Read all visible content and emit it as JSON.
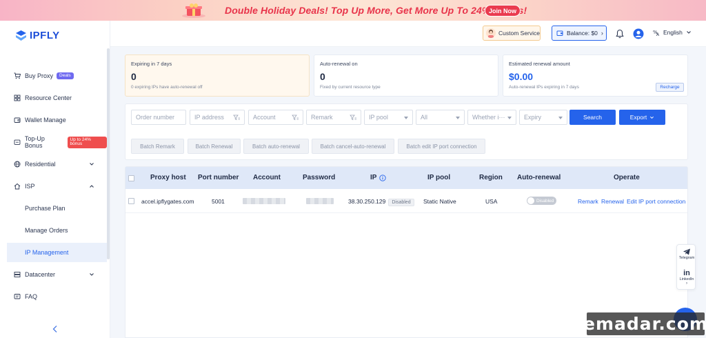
{
  "banner": {
    "text": "Double Holiday Deals! Top Up More, Get More Up To 24% Bonus!",
    "join_label": "Join Now"
  },
  "brand": {
    "name": "IPFLY",
    "accent": "#2563eb"
  },
  "sidebar": {
    "items": [
      {
        "label": "Buy Proxy",
        "icon": "cart-icon",
        "badge": "Deals"
      },
      {
        "label": "Resource Center",
        "icon": "grid-icon"
      },
      {
        "label": "Wallet Manage",
        "icon": "wallet-icon"
      },
      {
        "label": "Top-Up Bonus",
        "icon": "coupon-icon",
        "badge": "Up to 24% bonus"
      },
      {
        "label": "Residential",
        "icon": "globe-icon"
      },
      {
        "label": "ISP",
        "icon": "home-icon"
      },
      {
        "label": "Purchase Plan"
      },
      {
        "label": "Manage Orders"
      },
      {
        "label": "IP Management",
        "active": true
      },
      {
        "label": "Datacenter",
        "icon": "server-icon"
      },
      {
        "label": "FAQ",
        "icon": "faq-icon"
      }
    ]
  },
  "header": {
    "custom_service": "Custom Service",
    "balance": "Balance: $0",
    "language": "English"
  },
  "cards": [
    {
      "label": "Expiring in 7 days",
      "value": "0",
      "sub": "0 expiring IPs have auto-renewal off"
    },
    {
      "label": "Auto-renewal on",
      "value": "0",
      "sub": "Fixed by current resource type"
    },
    {
      "label": "Estimated renewal amount",
      "value": "$0.00",
      "sub": "Auto-renewal IPs expiring in 7 days",
      "action": "Recharge"
    }
  ],
  "filters": {
    "order_number": "Order number",
    "ip_address": "IP address",
    "account": "Account",
    "remark": "Remark",
    "ip_pool": "IP pool",
    "all": "All",
    "whether": "Whether i···",
    "expiry": "Expiry",
    "search": "Search",
    "export": "Export"
  },
  "batch": [
    "Batch Remark",
    "Batch Renewal",
    "Batch auto-renewal",
    "Batch cancel-auto-renewal",
    "Batch edit IP port connection"
  ],
  "table": {
    "columns": [
      "Proxy host",
      "Port number",
      "Account",
      "Password",
      "IP",
      "IP pool",
      "Region",
      "Auto-renewal",
      "Operate"
    ],
    "rows": [
      {
        "proxy_host": "accel.ipflygates.com",
        "port": "5001",
        "ip": "38.30.250.129",
        "ip_status": "Disabled",
        "ip_pool": "Static Native",
        "region": "USA",
        "auto_renewal": "Disabled",
        "ops": [
          "Remark",
          "Renewal",
          "Edit IP port connection"
        ]
      }
    ]
  },
  "float": {
    "telegram": "Telegram",
    "linkedin": "LinkedIn"
  },
  "watermark": "emadar.com"
}
